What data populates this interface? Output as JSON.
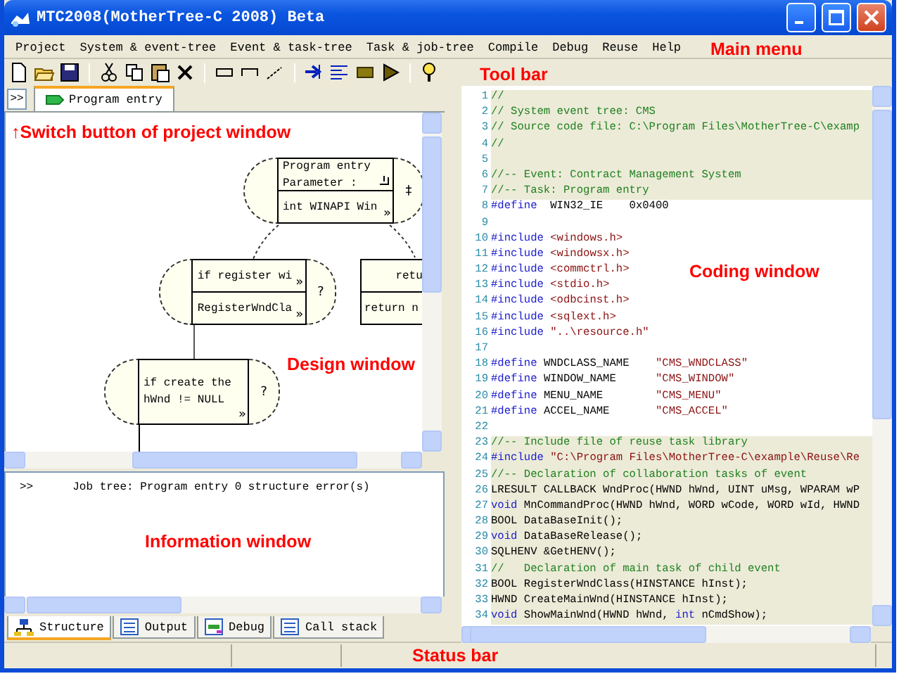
{
  "window": {
    "title": "MTC2008(MotherTree-C 2008) Beta"
  },
  "menu": [
    "Project",
    "System & event-tree",
    "Event & task-tree",
    "Task & job-tree",
    "Compile",
    "Debug",
    "Reuse",
    "Help"
  ],
  "project_window": {
    "switch_button": ">>",
    "tabs": [
      {
        "label": "Program entry",
        "selected": true
      }
    ]
  },
  "design": {
    "nodes": [
      {
        "kind": "module",
        "cap": "‡",
        "rows": [
          {
            "lines": [
              "Program entry",
              "Parameter :"
            ],
            "end_mark": true
          },
          {
            "lines": [
              "int WINAPI Win"
            ],
            "marker": "»"
          }
        ]
      },
      {
        "kind": "module",
        "cap": "?",
        "rows": [
          {
            "lines": [
              "if register wi"
            ],
            "marker": "»"
          },
          {
            "lines": [
              "RegisterWndCla"
            ],
            "marker": "»"
          }
        ]
      },
      {
        "kind": "plain",
        "rows": [
          {
            "lines": [
              "retu"
            ]
          },
          {
            "lines": [
              "return n"
            ]
          }
        ]
      },
      {
        "kind": "module",
        "cap": "?",
        "rows": [
          {
            "lines": [
              "if create the",
              "hWnd != NULL"
            ],
            "marker": "»"
          }
        ]
      }
    ]
  },
  "info": {
    "lines": [
      {
        "marker": ">>",
        "text": "Job tree: Program entry 0 structure error(s)"
      }
    ]
  },
  "bottom_tabs": [
    {
      "label": "Structure",
      "selected": true
    },
    {
      "label": "Output",
      "selected": false
    },
    {
      "label": "Debug",
      "selected": false
    },
    {
      "label": "Call stack",
      "selected": false
    }
  ],
  "code": {
    "lines": [
      {
        "number": "1",
        "shaded": true,
        "tokens": [
          {
            "kind": "comment",
            "text": "//"
          }
        ]
      },
      {
        "number": "2",
        "shaded": true,
        "tokens": [
          {
            "kind": "comment",
            "text": "// System event tree: CMS"
          }
        ]
      },
      {
        "number": "3",
        "shaded": true,
        "tokens": [
          {
            "kind": "comment",
            "text": "// Source code file: C:\\Program Files\\MotherTree-C\\examp"
          }
        ]
      },
      {
        "number": "4",
        "shaded": true,
        "tokens": [
          {
            "kind": "comment",
            "text": "//"
          }
        ]
      },
      {
        "number": "5",
        "shaded": true
      },
      {
        "number": "6",
        "shaded": true,
        "tokens": [
          {
            "kind": "comment",
            "text": "//-- Event: Contract Management System"
          }
        ]
      },
      {
        "number": "7",
        "shaded": true,
        "tokens": [
          {
            "kind": "comment",
            "text": "//-- Task: Program entry"
          }
        ]
      },
      {
        "number": "8",
        "shaded": false,
        "tokens": [
          {
            "kind": "keyword",
            "text": "#define"
          },
          {
            "kind": "plain",
            "text": "  WIN32_IE    0x0400"
          }
        ]
      },
      {
        "number": "9",
        "shaded": false
      },
      {
        "number": "10",
        "shaded": false,
        "tokens": [
          {
            "kind": "keyword",
            "text": "#include"
          },
          {
            "kind": "string",
            "text": " <windows.h>"
          }
        ]
      },
      {
        "number": "11",
        "shaded": false,
        "tokens": [
          {
            "kind": "keyword",
            "text": "#include"
          },
          {
            "kind": "string",
            "text": " <windowsx.h>"
          }
        ]
      },
      {
        "number": "12",
        "shaded": false,
        "tokens": [
          {
            "kind": "keyword",
            "text": "#include"
          },
          {
            "kind": "string",
            "text": " <commctrl.h>"
          }
        ]
      },
      {
        "number": "13",
        "shaded": false,
        "tokens": [
          {
            "kind": "keyword",
            "text": "#include"
          },
          {
            "kind": "string",
            "text": " <stdio.h>"
          }
        ]
      },
      {
        "number": "14",
        "shaded": false,
        "tokens": [
          {
            "kind": "keyword",
            "text": "#include"
          },
          {
            "kind": "string",
            "text": " <odbcinst.h>"
          }
        ]
      },
      {
        "number": "15",
        "shaded": false,
        "tokens": [
          {
            "kind": "keyword",
            "text": "#include"
          },
          {
            "kind": "string",
            "text": " <sqlext.h>"
          }
        ]
      },
      {
        "number": "16",
        "shaded": false,
        "tokens": [
          {
            "kind": "keyword",
            "text": "#include"
          },
          {
            "kind": "string",
            "text": " \"..\\resource.h\""
          }
        ]
      },
      {
        "number": "17",
        "shaded": false
      },
      {
        "number": "18",
        "shaded": false,
        "tokens": [
          {
            "kind": "keyword",
            "text": "#define"
          },
          {
            "kind": "plain",
            "text": " WNDCLASS_NAME    "
          },
          {
            "kind": "string",
            "text": "\"CMS_WNDCLASS\""
          }
        ]
      },
      {
        "number": "19",
        "shaded": false,
        "tokens": [
          {
            "kind": "keyword",
            "text": "#define"
          },
          {
            "kind": "plain",
            "text": " WINDOW_NAME      "
          },
          {
            "kind": "string",
            "text": "\"CMS_WINDOW\""
          }
        ]
      },
      {
        "number": "20",
        "shaded": false,
        "tokens": [
          {
            "kind": "keyword",
            "text": "#define"
          },
          {
            "kind": "plain",
            "text": " MENU_NAME        "
          },
          {
            "kind": "string",
            "text": "\"CMS_MENU\""
          }
        ]
      },
      {
        "number": "21",
        "shaded": false,
        "tokens": [
          {
            "kind": "keyword",
            "text": "#define"
          },
          {
            "kind": "plain",
            "text": " ACCEL_NAME       "
          },
          {
            "kind": "string",
            "text": "\"CMS_ACCEL\""
          }
        ]
      },
      {
        "number": "22",
        "shaded": false
      },
      {
        "number": "23",
        "shaded": true,
        "tokens": [
          {
            "kind": "comment",
            "text": "//-- Include file of reuse task library"
          }
        ]
      },
      {
        "number": "24",
        "shaded": true,
        "tokens": [
          {
            "kind": "keyword",
            "text": "#include"
          },
          {
            "kind": "string",
            "text": " \"C:\\Program Files\\MotherTree-C\\example\\Reuse\\Re"
          }
        ]
      },
      {
        "number": "25",
        "shaded": true,
        "tokens": [
          {
            "kind": "comment",
            "text": "//-- Declaration of collaboration tasks of event"
          }
        ]
      },
      {
        "number": "26",
        "shaded": true,
        "tokens": [
          {
            "kind": "plain",
            "text": "LRESULT CALLBACK WndProc(HWND hWnd, UINT uMsg, WPARAM wP"
          }
        ]
      },
      {
        "number": "27",
        "shaded": true,
        "tokens": [
          {
            "kind": "keyword",
            "text": "void"
          },
          {
            "kind": "plain",
            "text": " MnCommandProc(HWND hWnd, WORD wCode, WORD wId, HWND"
          }
        ]
      },
      {
        "number": "28",
        "shaded": true,
        "tokens": [
          {
            "kind": "plain",
            "text": "BOOL DataBaseInit();"
          }
        ]
      },
      {
        "number": "29",
        "shaded": true,
        "tokens": [
          {
            "kind": "keyword",
            "text": "void"
          },
          {
            "kind": "plain",
            "text": " DataBaseRelease();"
          }
        ]
      },
      {
        "number": "30",
        "shaded": true,
        "tokens": [
          {
            "kind": "plain",
            "text": "SQLHENV &GetHENV();"
          }
        ]
      },
      {
        "number": "31",
        "shaded": true,
        "tokens": [
          {
            "kind": "comment",
            "text": "//   Declaration of main task of child event"
          }
        ]
      },
      {
        "number": "32",
        "shaded": true,
        "tokens": [
          {
            "kind": "plain",
            "text": "BOOL RegisterWndClass(HINSTANCE hInst);"
          }
        ]
      },
      {
        "number": "33",
        "shaded": true,
        "tokens": [
          {
            "kind": "plain",
            "text": "HWND CreateMainWnd(HINSTANCE hInst);"
          }
        ]
      },
      {
        "number": "34",
        "shaded": true,
        "tokens": [
          {
            "kind": "keyword",
            "text": "void"
          },
          {
            "kind": "plain",
            "text": " ShowMainWnd(HWND hWnd, "
          },
          {
            "kind": "keyword",
            "text": "int"
          },
          {
            "kind": "plain",
            "text": " nCmdShow);"
          }
        ]
      }
    ]
  },
  "annotations": [
    "Main menu",
    "Tool bar",
    "↑Switch button of project window",
    "Design window",
    "Coding window",
    "Information window",
    "Status bar"
  ]
}
